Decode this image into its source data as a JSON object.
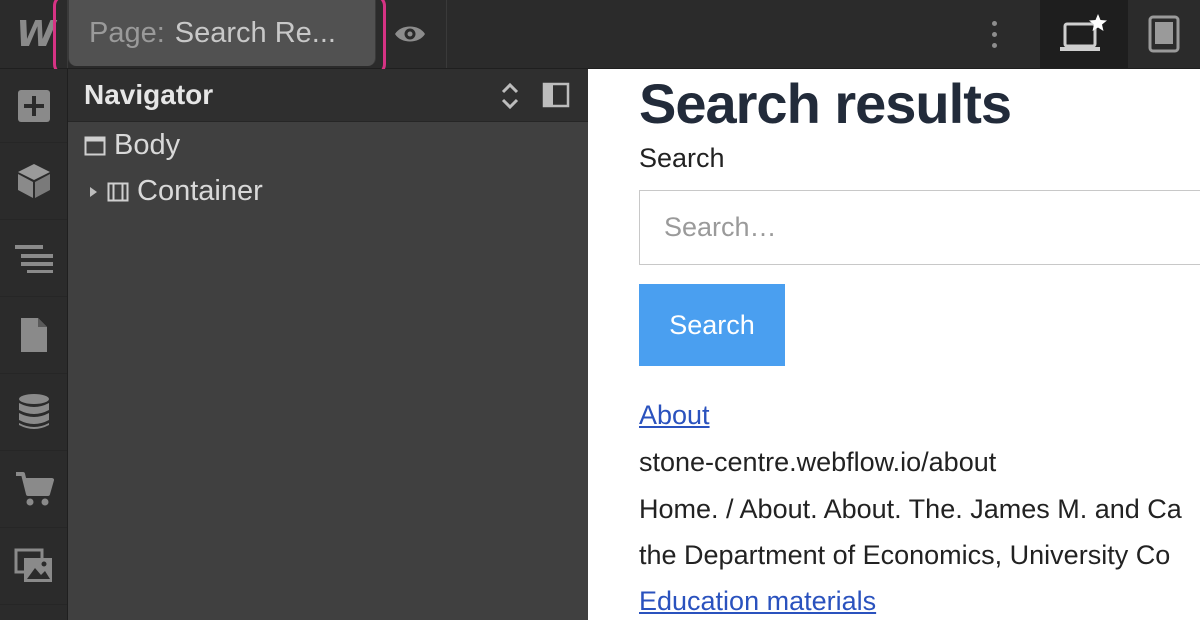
{
  "topbar": {
    "logo": "W",
    "page_prefix": "Page:",
    "page_name": "Search Re...",
    "preview_icon": "eye-icon",
    "more_icon": "kebab-icon",
    "devices": [
      {
        "name": "desktop-star-icon",
        "active": true
      },
      {
        "name": "tablet-icon",
        "active": false
      }
    ],
    "highlight_color": "#d63384"
  },
  "left_toolbar": {
    "items": [
      {
        "icon": "plus-icon"
      },
      {
        "icon": "cube-icon"
      },
      {
        "icon": "navigator-icon"
      },
      {
        "icon": "page-icon"
      },
      {
        "icon": "database-icon"
      },
      {
        "icon": "cart-icon"
      },
      {
        "icon": "assets-icon"
      }
    ]
  },
  "navigator": {
    "title": "Navigator",
    "tree": [
      {
        "label": "Body",
        "icon": "body-icon"
      },
      {
        "label": "Container",
        "icon": "container-icon"
      }
    ]
  },
  "canvas": {
    "heading": "Search results",
    "search_label": "Search",
    "search_placeholder": "Search…",
    "search_button": "Search",
    "results": [
      {
        "title": "About",
        "url": "stone-centre.webflow.io/about",
        "snippet_line1": "Home. / About. About. The. James M. and Ca",
        "snippet_line2": "the Department of Economics, University Co"
      },
      {
        "title": "Education materials"
      }
    ],
    "accent_color": "#4a9ff0",
    "link_color": "#2a52be"
  }
}
